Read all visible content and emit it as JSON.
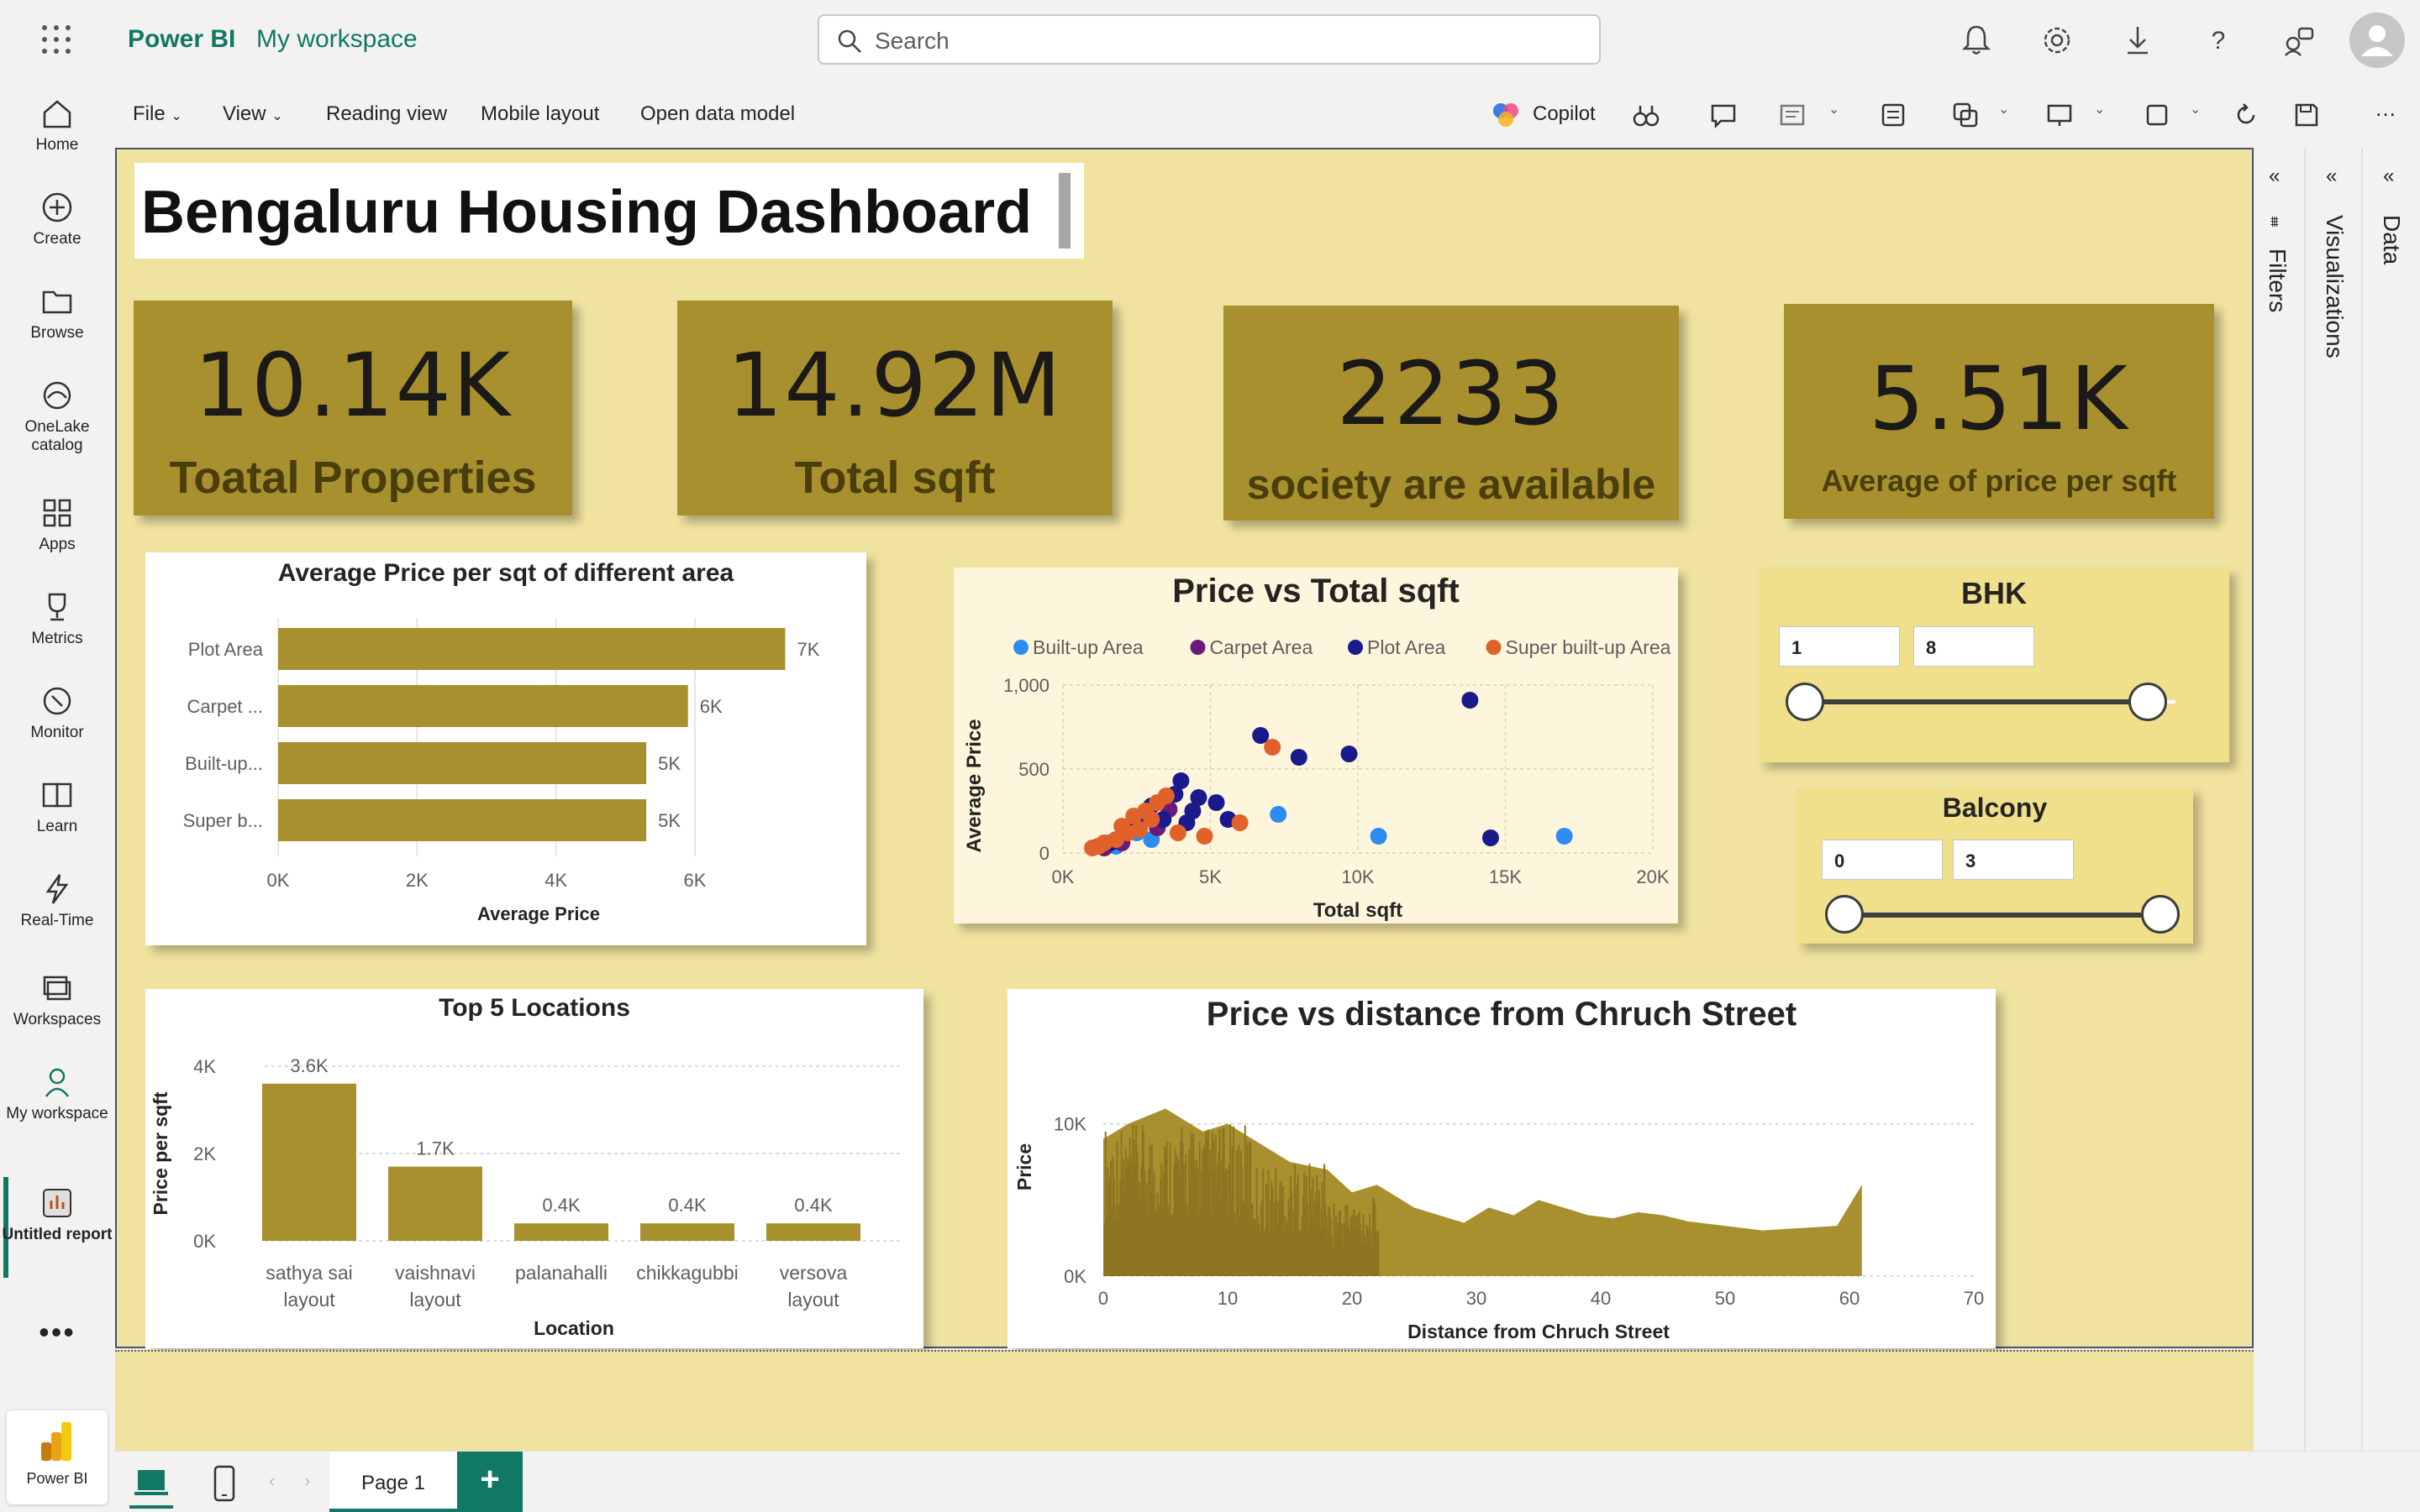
{
  "app": {
    "name": "Power BI",
    "workspace": "My workspace"
  },
  "search": {
    "placeholder": "Search"
  },
  "nav": [
    {
      "id": "home",
      "label": "Home"
    },
    {
      "id": "create",
      "label": "Create"
    },
    {
      "id": "browse",
      "label": "Browse"
    },
    {
      "id": "onelake",
      "label": "OneLake catalog"
    },
    {
      "id": "apps",
      "label": "Apps"
    },
    {
      "id": "metrics",
      "label": "Metrics"
    },
    {
      "id": "monitor",
      "label": "Monitor"
    },
    {
      "id": "learn",
      "label": "Learn"
    },
    {
      "id": "realtime",
      "label": "Real-Time"
    },
    {
      "id": "workspaces",
      "label": "Workspaces"
    },
    {
      "id": "myworkspace",
      "label": "My workspace"
    },
    {
      "id": "untitled",
      "label": "Untitled report"
    }
  ],
  "toolbar": {
    "file": "File",
    "view": "View",
    "reading_view": "Reading view",
    "mobile_layout": "Mobile layout",
    "open_data_model": "Open data model",
    "copilot": "Copilot"
  },
  "dashboard": {
    "title": "Bengaluru Housing Dashboard",
    "cards": [
      {
        "value": "10.14K",
        "label": "Toatal Properties"
      },
      {
        "value": "14.92M",
        "label": "Total sqft"
      },
      {
        "value": "2233",
        "label": "society are available"
      },
      {
        "value": "5.51K",
        "label": "Average of price per sqft"
      }
    ]
  },
  "slicers": {
    "bhk": {
      "title": "BHK",
      "min": "1",
      "max": "8"
    },
    "balcony": {
      "title": "Balcony",
      "min": "0",
      "max": "3"
    }
  },
  "panes": {
    "filters": "Filters",
    "visualizations": "Visualizations",
    "data": "Data"
  },
  "pages": {
    "page1": "Page 1",
    "add": "+"
  },
  "colors": {
    "bar": "#a8902e",
    "canvas": "#f0e3a0",
    "card": "#a8902e",
    "builtup": "#2e8cf0",
    "carpet": "#6a1b7a",
    "plot": "#1a1a8c",
    "superbuiltup": "#e0622a"
  },
  "chart_data": [
    {
      "type": "bar",
      "orientation": "horizontal",
      "title": "Average Price per sqt of different area",
      "categories": [
        "Plot Area",
        "Carpet ...",
        "Built-up...",
        "Super b..."
      ],
      "values": [
        7300,
        5900,
        5300,
        5300
      ],
      "data_labels": [
        "7K",
        "6K",
        "5K",
        "5K"
      ],
      "xlabel": "Average Price",
      "ylabel": "",
      "xlim": [
        0,
        7500
      ],
      "x_ticks": [
        "0K",
        "2K",
        "4K",
        "6K"
      ]
    },
    {
      "type": "scatter",
      "title": "Price vs Total sqft",
      "xlabel": "Total sqft",
      "ylabel": "Average Price",
      "xlim": [
        0,
        20000
      ],
      "ylim": [
        0,
        1000
      ],
      "x_ticks": [
        "0K",
        "5K",
        "10K",
        "15K",
        "20K"
      ],
      "y_ticks": [
        "0",
        "500",
        "1,000"
      ],
      "legend_position": "top",
      "series": [
        {
          "name": "Built-up   Area",
          "color": "#2e8cf0",
          "points": [
            [
              7300,
              230
            ],
            [
              10700,
              100
            ],
            [
              17000,
              100
            ],
            [
              3000,
              80
            ],
            [
              1800,
              40
            ],
            [
              2500,
              120
            ]
          ]
        },
        {
          "name": "Carpet   Area",
          "color": "#6a1b7a",
          "points": [
            [
              2000,
              60
            ],
            [
              3200,
              150
            ],
            [
              1400,
              30
            ],
            [
              3600,
              260
            ]
          ]
        },
        {
          "name": "Plot   Area",
          "color": "#1a1a8c",
          "points": [
            [
              13800,
              910
            ],
            [
              6700,
              700
            ],
            [
              8000,
              570
            ],
            [
              9700,
              590
            ],
            [
              14500,
              90
            ],
            [
              4000,
              430
            ],
            [
              5200,
              300
            ],
            [
              4600,
              330
            ],
            [
              5600,
              200
            ],
            [
              3800,
              350
            ],
            [
              4400,
              250
            ],
            [
              3000,
              280
            ],
            [
              2500,
              190
            ],
            [
              1600,
              60
            ],
            [
              3400,
              200
            ],
            [
              4200,
              180
            ]
          ]
        },
        {
          "name": "Super built-up   Area",
          "color": "#e0622a",
          "points": [
            [
              7100,
              630
            ],
            [
              6000,
              180
            ],
            [
              4800,
              100
            ],
            [
              2800,
              250
            ],
            [
              3200,
              300
            ],
            [
              3000,
              200
            ],
            [
              2600,
              140
            ],
            [
              2200,
              120
            ],
            [
              1800,
              80
            ],
            [
              1400,
              60
            ],
            [
              1200,
              40
            ],
            [
              3500,
              340
            ],
            [
              2400,
              220
            ],
            [
              2000,
              160
            ],
            [
              1000,
              30
            ],
            [
              3900,
              120
            ]
          ]
        }
      ]
    },
    {
      "type": "bar",
      "title": "Top 5 Locations",
      "categories": [
        "sathya sai layout",
        "vaishnavi layout",
        "palanahalli",
        "chikkagubbi",
        "versova layout"
      ],
      "values": [
        3600,
        1700,
        400,
        400,
        400
      ],
      "data_labels": [
        "3.6K",
        "1.7K",
        "0.4K",
        "0.4K",
        "0.4K"
      ],
      "xlabel": "Location",
      "ylabel": "Price per sqft",
      "ylim": [
        0,
        4000
      ],
      "y_ticks": [
        "0K",
        "2K",
        "4K"
      ]
    },
    {
      "type": "area",
      "title": "Price vs distance from Chruch Street",
      "xlabel": "Distance from Chruch Street",
      "ylabel": "Price",
      "xlim": [
        0,
        70
      ],
      "ylim": [
        0,
        15000
      ],
      "x_ticks": [
        "0",
        "10",
        "20",
        "30",
        "40",
        "50",
        "60",
        "70"
      ],
      "y_ticks": [
        "0K",
        "10K"
      ],
      "x": [
        0,
        2,
        5,
        8,
        10,
        12,
        15,
        18,
        20,
        22,
        25,
        27,
        29,
        31,
        33,
        35,
        37,
        39,
        41,
        43,
        45,
        47,
        49,
        51,
        53,
        55,
        57,
        59,
        61
      ],
      "values": [
        9000,
        10000,
        11000,
        9500,
        10000,
        9000,
        7500,
        7000,
        5500,
        6000,
        4500,
        4000,
        3500,
        4500,
        4000,
        5000,
        4500,
        4000,
        3800,
        4200,
        4000,
        3600,
        3400,
        3200,
        3000,
        3100,
        3200,
        3300,
        6000
      ]
    }
  ]
}
